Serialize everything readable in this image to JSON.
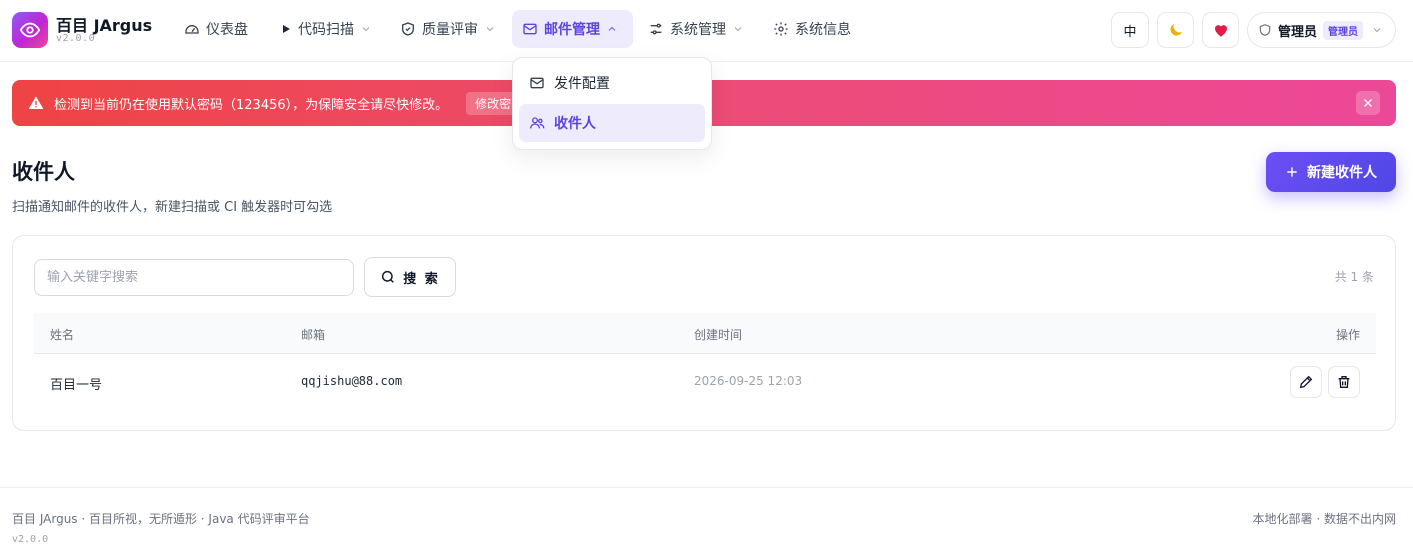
{
  "app": {
    "name": "百目 JArgus",
    "version": "v2.0.0"
  },
  "nav": {
    "items": [
      {
        "label": "仪表盘",
        "icon": "gauge-icon"
      },
      {
        "label": "代码扫描",
        "icon": "play-icon"
      },
      {
        "label": "质量评审",
        "icon": "shield-icon"
      },
      {
        "label": "邮件管理",
        "icon": "mail-icon",
        "active": true
      },
      {
        "label": "系统管理",
        "icon": "sliders-icon"
      },
      {
        "label": "系统信息",
        "icon": "gear-icon"
      }
    ],
    "dropdown": [
      {
        "label": "发件配置",
        "icon": "mail-icon"
      },
      {
        "label": "收件人",
        "icon": "users-icon",
        "selected": true
      }
    ]
  },
  "toolbar": {
    "lang": "中",
    "theme_icon": "moon-icon",
    "heart_icon": "heart-icon"
  },
  "user": {
    "name": "管理员",
    "role": "管理员"
  },
  "alert": {
    "text": "检测到当前仍在使用默认密码（123456），为保障安全请尽快修改。",
    "action": "修改密"
  },
  "page": {
    "title": "收件人",
    "subtitle": "扫描通知邮件的收件人，新建扫描或 CI 触发器时可勾选",
    "new_button": "新建收件人"
  },
  "search": {
    "placeholder": "输入关键字搜索",
    "value": "",
    "button": "搜 索",
    "total": "共 1 条"
  },
  "table": {
    "columns": [
      "姓名",
      "邮箱",
      "创建时间",
      "操作"
    ],
    "rows": [
      {
        "name": "百目一号",
        "email": "qqjishu@88.com",
        "created": "2026-09-25 12:03"
      }
    ]
  },
  "footer": {
    "left": "百目 JArgus · 百目所视，无所遁形 · Java 代码评审平台",
    "version": "v2.0.0",
    "right": "本地化部署 · 数据不出内网"
  },
  "colors": {
    "accent": "#5b45e0",
    "alert_start": "#ef4444",
    "alert_end": "#ec4899"
  }
}
